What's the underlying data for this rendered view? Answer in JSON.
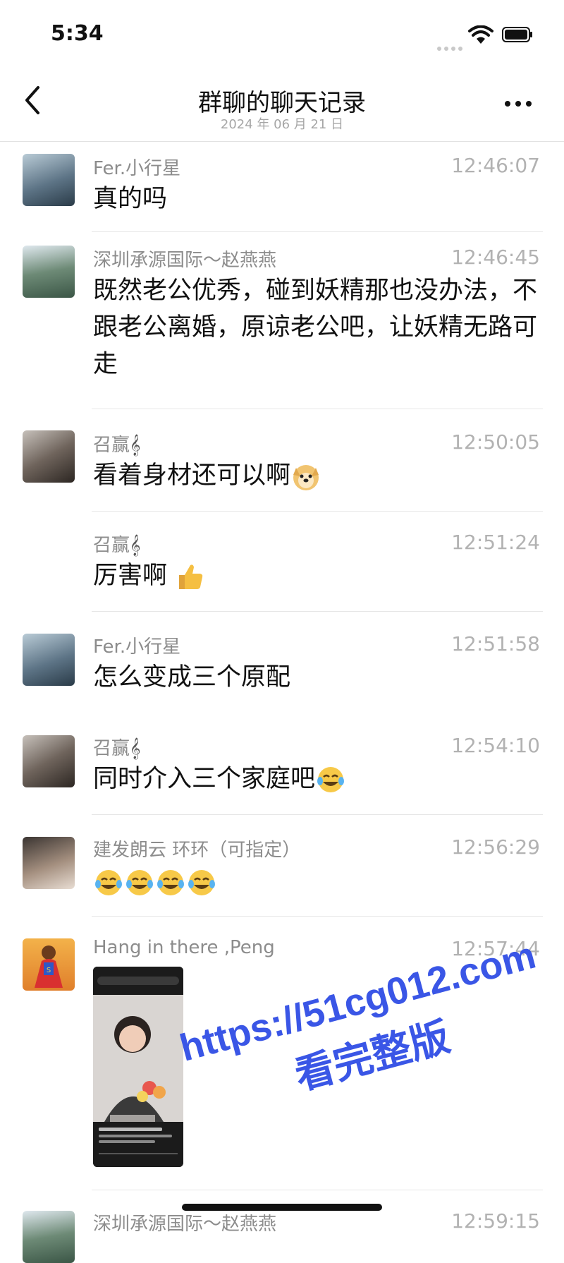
{
  "status_bar": {
    "time": "5:34"
  },
  "nav": {
    "title": "群聊的聊天记录",
    "date": "2024 年 06 月 21 日"
  },
  "messages": [
    {
      "sender": "Fer.小行星",
      "time": "12:46:07",
      "text": "真的吗"
    },
    {
      "sender": "深圳承源国际～赵燕燕",
      "time": "12:46:45",
      "text": "既然老公优秀，碰到妖精那也没办法，不跟老公离婚，原谅老公吧，让妖精无路可走"
    },
    {
      "sender": "召赢",
      "time": "12:50:05",
      "text": "看着身材还可以啊",
      "emoji": "doge-emoji"
    },
    {
      "sender": "召赢",
      "time": "12:51:24",
      "text": "厉害啊",
      "emoji": "thumbs-up-emoji"
    },
    {
      "sender": "Fer.小行星",
      "time": "12:51:58",
      "text": "怎么变成三个原配"
    },
    {
      "sender": "召赢",
      "time": "12:54:10",
      "text": "同时介入三个家庭吧",
      "emoji": "tears-of-joy-emoji"
    },
    {
      "sender": "建发朗云 环环（可指定）",
      "time": "12:56:29",
      "text": "",
      "emoji": "tears-of-joy-emoji-x4"
    },
    {
      "sender": "Hang in there ,Peng",
      "time": "12:57:44",
      "text": "",
      "attachment": "video-clip"
    },
    {
      "sender": "深圳承源国际～赵燕燕",
      "time": "12:59:15",
      "text": ""
    }
  ],
  "watermark": {
    "line1": "https://51cg012.com",
    "line2": "看完整版"
  },
  "colors": {
    "text": "#111111",
    "meta": "#8c8c8c",
    "time": "#b2b2b2",
    "watermark": "#3a56e6"
  }
}
